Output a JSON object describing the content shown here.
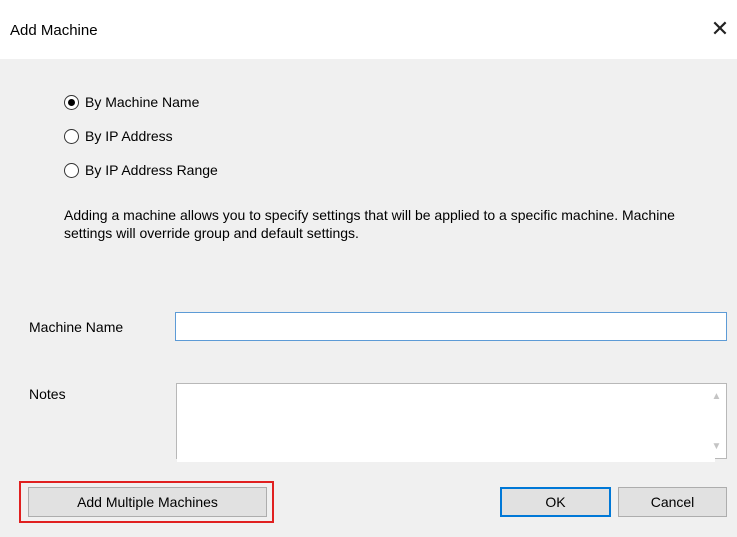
{
  "window": {
    "title": "Add Machine",
    "close_glyph": "✕"
  },
  "mode_options": [
    {
      "label": "By Machine Name",
      "checked": true
    },
    {
      "label": "By IP Address",
      "checked": false
    },
    {
      "label": "By IP Address Range",
      "checked": false
    }
  ],
  "description": "Adding a machine allows you to specify settings that will be applied to a specific machine.  Machine settings will override group and default settings.",
  "form": {
    "machine_name_label": "Machine Name",
    "machine_name_value": "",
    "notes_label": "Notes",
    "notes_value": ""
  },
  "buttons": {
    "add_multiple": "Add Multiple Machines",
    "ok": "OK",
    "cancel": "Cancel"
  },
  "colors": {
    "focus_border": "#5d9bd6",
    "default_button_border": "#0078d7",
    "highlight_box": "#e02020"
  }
}
